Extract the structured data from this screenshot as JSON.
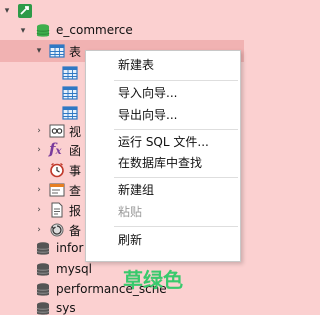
{
  "tree": {
    "connection_icon": "connection-icon",
    "database": {
      "label": "e_commerce",
      "expanded": true
    },
    "tables_folder": {
      "label": "表"
    },
    "children": [
      {
        "label": "视",
        "icon": "view-icon"
      },
      {
        "label": "函",
        "icon": "function-icon"
      },
      {
        "label": "事",
        "icon": "event-icon"
      },
      {
        "label": "查",
        "icon": "query-icon"
      },
      {
        "label": "报",
        "icon": "report-icon"
      },
      {
        "label": "备",
        "icon": "backup-icon"
      }
    ],
    "other_databases": [
      {
        "label": "infor"
      },
      {
        "label": "mysql"
      },
      {
        "label": "performance_sche"
      },
      {
        "label": "sys"
      }
    ]
  },
  "context_menu": {
    "new_table": "新建表",
    "import_wizard": "导入向导...",
    "export_wizard": "导出向导...",
    "run_sql_file": "运行 SQL 文件...",
    "find_in_database": "在数据库中查找",
    "new_group": "新建组",
    "paste": "粘贴",
    "refresh": "刷新"
  },
  "color_label": "草绿色",
  "colors": {
    "background": "#fbd0d0",
    "accent_green": "#39c96c",
    "db_icon": "#4d4d4d",
    "table_icon": "#2f78c4"
  }
}
